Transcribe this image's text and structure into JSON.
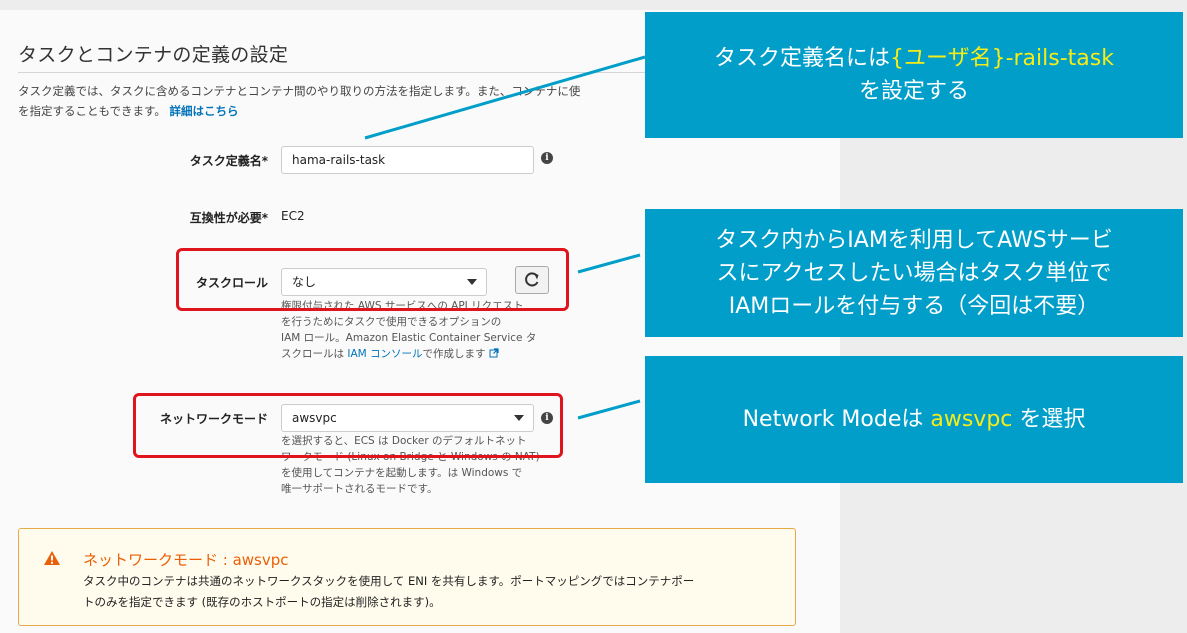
{
  "section": {
    "title": "タスクとコンテナの定義の設定",
    "description": "タスク定義では、タスクに含めるコンテナとコンテナ間のやり取りの方法を指定します。また、コンテナに使",
    "description_line2": "を指定することもできます。",
    "details_link": "詳細はこちら"
  },
  "form": {
    "task_definition_name": {
      "label": "タスク定義名*",
      "value": "hama-rails-task"
    },
    "compatibility": {
      "label": "互換性が必要*",
      "value": "EC2"
    },
    "task_role": {
      "label": "タスクロール",
      "value": "なし",
      "help_lines": [
        "権限付与された AWS サービスへの API リクエスト",
        "を行うためにタスクで使用できるオプションの",
        "IAM ロール。Amazon Elastic Container Service タ"
      ],
      "help_last_prefix": "スクロールは",
      "help_link": "IAM コンソール",
      "help_last_suffix": "で作成します"
    },
    "network_mode": {
      "label": "ネットワークモード",
      "value": "awsvpc",
      "help_lines": [
        "を選択すると、ECS は Docker のデフォルトネット",
        "ワークモード (Linux on Bridge と Windows の NAT)",
        "を使用してコンテナを起動します。は Windows で",
        "唯一サポートされるモードです。"
      ]
    }
  },
  "warning": {
    "title": "ネットワークモード : awsvpc",
    "line1": "タスク中のコンテナは共通のネットワークスタックを使用して ENI を共有します。ポートマッピングではコンテナポー",
    "line2": "トのみを指定できます (既存のホストポートの指定は削除されます)。"
  },
  "callouts": {
    "task_name": {
      "pre": "タスク定義名には",
      "highlight": "{ユーザ名}",
      "post": "-rails-task",
      "line2": "を設定する"
    },
    "task_role": {
      "line1": "タスク内からIAMを利用してAWSサービ",
      "line2": "スにアクセスしたい場合はタスク単位で",
      "line3": "IAMロールを付与する（今回は不要）"
    },
    "network_mode": {
      "pre": "Network Modeは ",
      "highlight": "awsvpc",
      "post": " を選択"
    }
  },
  "colors": {
    "callout_bg": "#009ec8",
    "callout_highlight": "#f5ec1a",
    "annotation_box": "#e0141c",
    "link": "#0073bb",
    "warning_title": "#eb5f07"
  }
}
